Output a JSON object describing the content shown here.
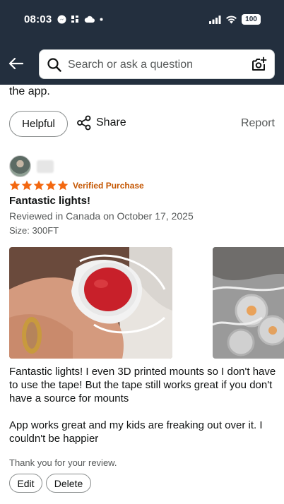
{
  "status_bar": {
    "time": "08:03",
    "battery": "100"
  },
  "header": {
    "search_placeholder": "Search or ask a question"
  },
  "previous_review": {
    "tail_text": "the app.",
    "helpful_label": "Helpful",
    "share_label": "Share",
    "report_label": "Report"
  },
  "review": {
    "rating": 5,
    "verified_label": "Verified Purchase",
    "title": "Fantastic lights!",
    "meta": "Reviewed in Canada on October 17, 2025",
    "size": "Size: 300FT",
    "body_paragraphs": [
      "Fantastic lights! I even 3D printed mounts so I don't have to use the tape! But the tape still works great if you don't have a source for mounts",
      "App works great and my kids are freaking out over it. I couldn't be happier"
    ],
    "thanks": "Thank you for your review.",
    "edit_label": "Edit",
    "delete_label": "Delete"
  },
  "colors": {
    "header_bg": "#232f3e",
    "star": "#f3670f",
    "verified": "#c45500"
  }
}
